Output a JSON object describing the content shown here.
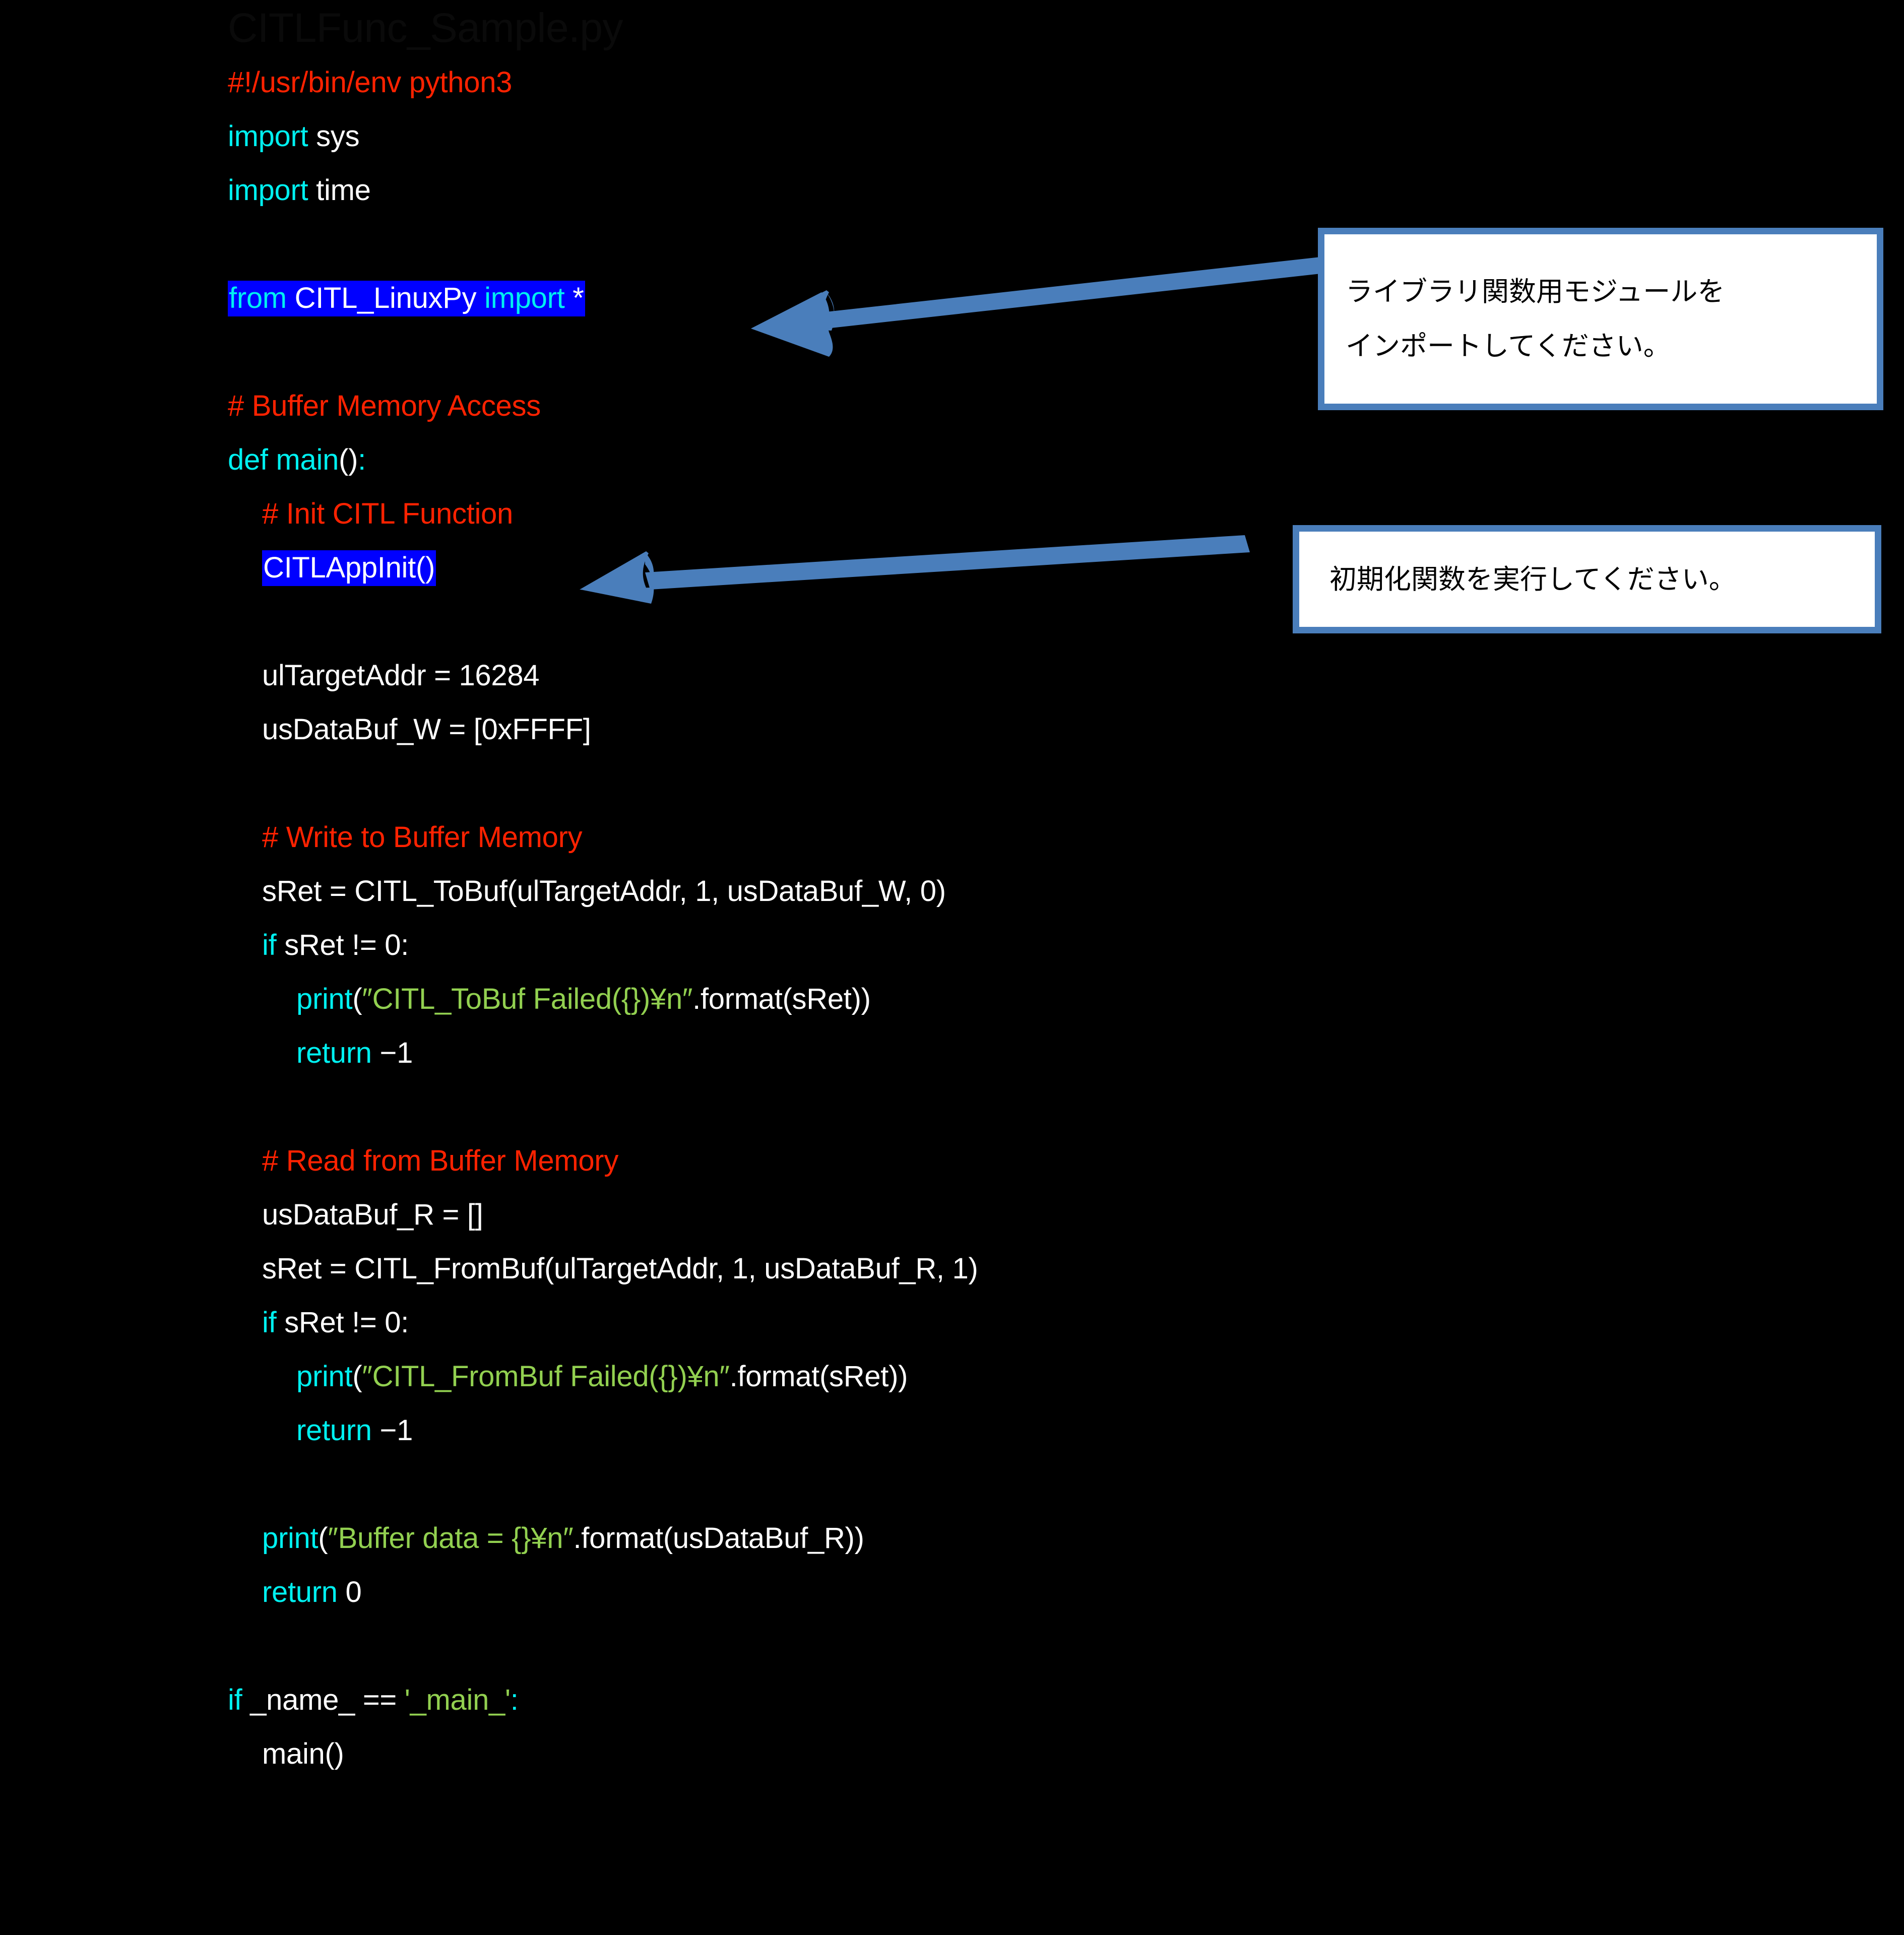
{
  "slide": {
    "background_color": "#000000",
    "title": "CITLFunc_Sample.py"
  },
  "colors": {
    "comment": "#ff2200",
    "keyword": "#00f0f0",
    "identifier": "#ffffff",
    "string": "#92d050",
    "highlight_background": "#0000ff",
    "callout_border": "#4a7ebb",
    "callout_background": "#ffffff",
    "arrow": "#4a7ebb",
    "title": "#0a0a0a"
  },
  "code": {
    "language": "python",
    "lines": [
      {
        "indent": 0,
        "blank": false,
        "highlight": false,
        "tokens": [
          {
            "t": "#!/usr/bin/env python3",
            "c": "comment"
          }
        ]
      },
      {
        "indent": 0,
        "blank": false,
        "highlight": false,
        "tokens": [
          {
            "t": "import ",
            "c": "keyword"
          },
          {
            "t": "sys",
            "c": "identifier"
          }
        ]
      },
      {
        "indent": 0,
        "blank": false,
        "highlight": false,
        "tokens": [
          {
            "t": "import ",
            "c": "keyword"
          },
          {
            "t": "time",
            "c": "identifier"
          }
        ]
      },
      {
        "indent": 0,
        "blank": true,
        "highlight": false,
        "tokens": []
      },
      {
        "indent": 0,
        "blank": false,
        "highlight": true,
        "tokens": [
          {
            "t": "from ",
            "c": "keyword"
          },
          {
            "t": "CITL_LinuxPy ",
            "c": "identifier"
          },
          {
            "t": "import ",
            "c": "keyword"
          },
          {
            "t": "*",
            "c": "identifier"
          }
        ]
      },
      {
        "indent": 0,
        "blank": true,
        "highlight": false,
        "tokens": []
      },
      {
        "indent": 0,
        "blank": false,
        "highlight": false,
        "tokens": [
          {
            "t": "# Buffer Memory Access",
            "c": "comment"
          }
        ]
      },
      {
        "indent": 0,
        "blank": false,
        "highlight": false,
        "tokens": [
          {
            "t": "def main",
            "c": "keyword"
          },
          {
            "t": "()",
            "c": "identifier"
          },
          {
            "t": ":",
            "c": "keyword"
          }
        ]
      },
      {
        "indent": 1,
        "blank": false,
        "highlight": false,
        "tokens": [
          {
            "t": "# Init CITL Function",
            "c": "comment"
          }
        ]
      },
      {
        "indent": 1,
        "blank": false,
        "highlight": true,
        "tokens": [
          {
            "t": "CITLAppInit()",
            "c": "identifier"
          }
        ]
      },
      {
        "indent": 1,
        "blank": true,
        "highlight": false,
        "tokens": []
      },
      {
        "indent": 1,
        "blank": false,
        "highlight": false,
        "tokens": [
          {
            "t": "ulTargetAddr = 16284",
            "c": "identifier"
          }
        ]
      },
      {
        "indent": 1,
        "blank": false,
        "highlight": false,
        "tokens": [
          {
            "t": "usDataBuf_W = [0xFFFF]",
            "c": "identifier"
          }
        ]
      },
      {
        "indent": 1,
        "blank": true,
        "highlight": false,
        "tokens": []
      },
      {
        "indent": 1,
        "blank": false,
        "highlight": false,
        "tokens": [
          {
            "t": "# Write to Buffer Memory",
            "c": "comment"
          }
        ]
      },
      {
        "indent": 1,
        "blank": false,
        "highlight": false,
        "tokens": [
          {
            "t": "sRet = CITL_ToBuf(ulTargetAddr, 1, usDataBuf_W, 0)",
            "c": "identifier"
          }
        ]
      },
      {
        "indent": 1,
        "blank": false,
        "highlight": false,
        "tokens": [
          {
            "t": "if ",
            "c": "keyword"
          },
          {
            "t": "sRet != 0:",
            "c": "identifier"
          }
        ]
      },
      {
        "indent": 2,
        "blank": false,
        "highlight": false,
        "tokens": [
          {
            "t": "print",
            "c": "keyword"
          },
          {
            "t": "(",
            "c": "identifier"
          },
          {
            "t": "″CITL_ToBuf Failed({})¥n″",
            "c": "string"
          },
          {
            "t": ".format(sRet))",
            "c": "identifier"
          }
        ]
      },
      {
        "indent": 2,
        "blank": false,
        "highlight": false,
        "tokens": [
          {
            "t": "return ",
            "c": "keyword"
          },
          {
            "t": "−1",
            "c": "identifier"
          }
        ]
      },
      {
        "indent": 1,
        "blank": true,
        "highlight": false,
        "tokens": []
      },
      {
        "indent": 1,
        "blank": false,
        "highlight": false,
        "tokens": [
          {
            "t": "# Read from Buffer Memory",
            "c": "comment"
          }
        ]
      },
      {
        "indent": 1,
        "blank": false,
        "highlight": false,
        "tokens": [
          {
            "t": "usDataBuf_R = []",
            "c": "identifier"
          }
        ]
      },
      {
        "indent": 1,
        "blank": false,
        "highlight": false,
        "tokens": [
          {
            "t": "sRet = CITL_FromBuf(ulTargetAddr, 1, usDataBuf_R, 1)",
            "c": "identifier"
          }
        ]
      },
      {
        "indent": 1,
        "blank": false,
        "highlight": false,
        "tokens": [
          {
            "t": "if ",
            "c": "keyword"
          },
          {
            "t": "sRet != 0:",
            "c": "identifier"
          }
        ]
      },
      {
        "indent": 2,
        "blank": false,
        "highlight": false,
        "tokens": [
          {
            "t": "print",
            "c": "keyword"
          },
          {
            "t": "(",
            "c": "identifier"
          },
          {
            "t": "″CITL_FromBuf Failed({})¥n″",
            "c": "string"
          },
          {
            "t": ".format(sRet))",
            "c": "identifier"
          }
        ]
      },
      {
        "indent": 2,
        "blank": false,
        "highlight": false,
        "tokens": [
          {
            "t": "return ",
            "c": "keyword"
          },
          {
            "t": "−1",
            "c": "identifier"
          }
        ]
      },
      {
        "indent": 1,
        "blank": true,
        "highlight": false,
        "tokens": []
      },
      {
        "indent": 1,
        "blank": false,
        "highlight": false,
        "tokens": [
          {
            "t": "print",
            "c": "keyword"
          },
          {
            "t": "(",
            "c": "identifier"
          },
          {
            "t": "″Buffer data = {}¥n″",
            "c": "string"
          },
          {
            "t": ".format(usDataBuf_R))",
            "c": "identifier"
          }
        ]
      },
      {
        "indent": 1,
        "blank": false,
        "highlight": false,
        "tokens": [
          {
            "t": "return ",
            "c": "keyword"
          },
          {
            "t": "0",
            "c": "identifier"
          }
        ]
      },
      {
        "indent": 0,
        "blank": true,
        "highlight": false,
        "tokens": []
      },
      {
        "indent": 0,
        "blank": false,
        "highlight": false,
        "tokens": [
          {
            "t": "if ",
            "c": "keyword"
          },
          {
            "t": "_name_ == ",
            "c": "identifier"
          },
          {
            "t": "'_main_'",
            "c": "string"
          },
          {
            "t": ":",
            "c": "keyword"
          }
        ]
      },
      {
        "indent": 1,
        "blank": false,
        "highlight": false,
        "tokens": [
          {
            "t": "main()",
            "c": "identifier"
          }
        ]
      }
    ]
  },
  "callouts": [
    {
      "id": "import",
      "lines": [
        "ライブラリ関数用モジュールを",
        "インポートしてください。"
      ]
    },
    {
      "id": "init",
      "lines": [
        "初期化関数を実行してください。"
      ]
    }
  ],
  "arrows": [
    {
      "id": "import-arrow",
      "direction": "left",
      "target": "from CITL_LinuxPy import *"
    },
    {
      "id": "init-arrow",
      "direction": "left",
      "target": "CITLAppInit()"
    }
  ]
}
